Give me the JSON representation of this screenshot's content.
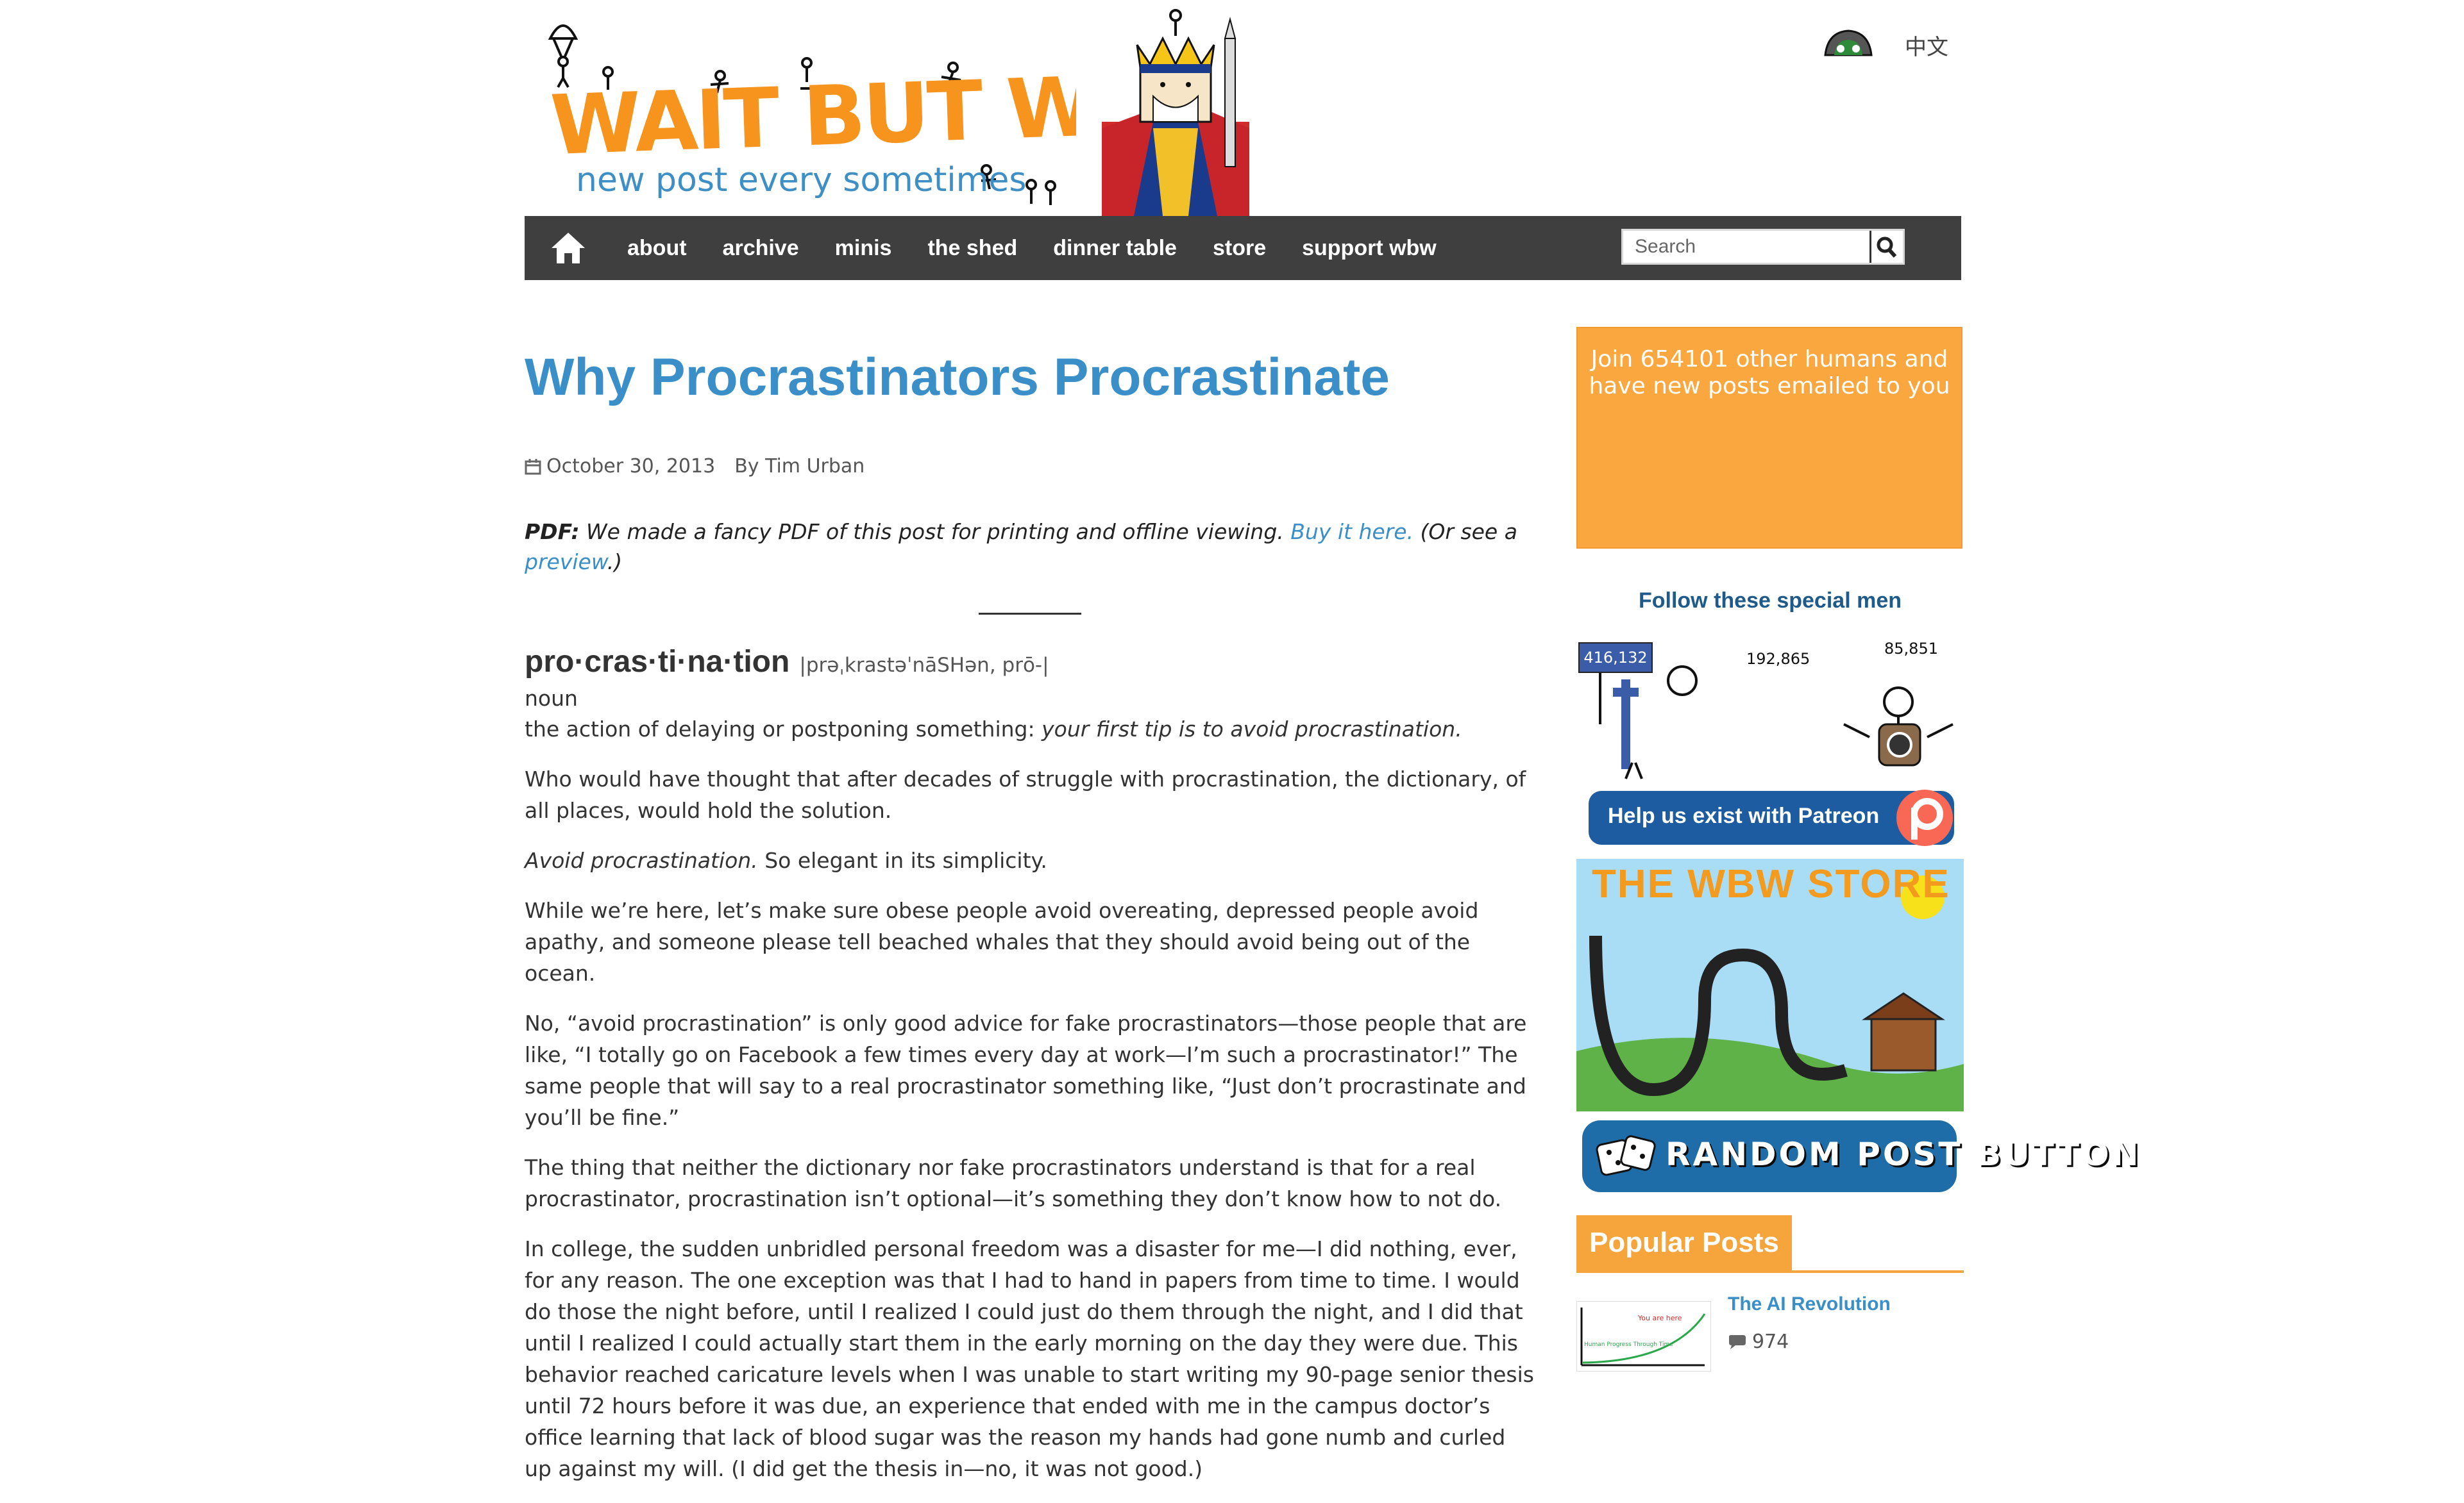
{
  "header": {
    "logo_title": "WAIT BUT WHY",
    "logo_tagline": "new post every sometimes",
    "language_link": "中文"
  },
  "nav": {
    "items": [
      "about",
      "archive",
      "minis",
      "the shed",
      "dinner table",
      "store",
      "support wbw"
    ],
    "search_placeholder": "Search"
  },
  "post": {
    "title": "Why Procrastinators Procrastinate",
    "date": "October 30, 2013",
    "author": "By Tim Urban",
    "pdf_label": "PDF:",
    "pdf_text": "We made a fancy PDF of this post for printing and offline viewing.",
    "pdf_link": "Buy it here.",
    "pdf_see": "(Or see a",
    "pdf_preview": "preview",
    "pdf_end": ".)",
    "definition": {
      "word": "pro·cras·ti·na·tion",
      "pronunciation": "|prəˌkrastəˈnāSHən, prō-|",
      "type": "noun",
      "meaning": "the action of delaying or postponing something:",
      "example": "your first tip is to avoid procrastination."
    },
    "paragraphs": [
      "Who would have thought that after decades of struggle with procrastination, the dictionary, of all places, would hold the solution.",
      "So elegant in its simplicity.",
      "While we’re here, let’s make sure obese people avoid overeating, depressed people avoid apathy, and someone please tell beached whales that they should avoid being out of the ocean.",
      "No, “avoid procrastination” is only good advice for fake procrastinators—those people that are like, “I totally go on Facebook a few times every day at work—I’m such a procrastinator!” The same people that will say to a real procrastinator something like, “Just don’t procrastinate and you’ll be fine.”",
      "The thing that neither the dictionary nor fake procrastinators understand is that for a real procrastinator, procrastination isn’t optional—it’s something they don’t know how to not do.",
      "In college, the sudden unbridled personal freedom was a disaster for me—I did nothing, ever, for any reason. The one exception was that I had to hand in papers from time to time. I would do those the night before, until I realized I could just do them through the night, and I did that until I realized I could actually start them in the early morning on the day they were due. This behavior reached caricature levels when I was unable to start writing my 90-page senior thesis until 72 hours before it was due, an experience that ended with me in the campus doctor’s office learning that lack of blood sugar was the reason my hands had gone numb and curled up against my will. (I did get the thesis in—no, it was not good.)"
    ],
    "para2_italic": "Avoid procrastination."
  },
  "sidebar": {
    "email_text": "Join 654101 other humans and have new posts emailed to you",
    "follow_title": "Follow these special men",
    "facebook_count": "416,132",
    "twitter_count": "192,865",
    "instagram_count": "85,851",
    "patreon_label": "Help us exist with Patreon",
    "store_title": "THE WBW STORE",
    "random_label": "RANDOM POST BUTTON",
    "popular_title": "Popular Posts",
    "popular_item_title": "The AI Revolution",
    "popular_item_count": "974",
    "thumb_you_are_here": "You are here",
    "thumb_axis_label": "Human Progress Through Time"
  },
  "colors": {
    "title_blue": "#3a8fc8",
    "nav_bg": "#3f3f3f",
    "accent_orange": "#f6a53c",
    "patreon_blue": "#1d5ca0"
  }
}
